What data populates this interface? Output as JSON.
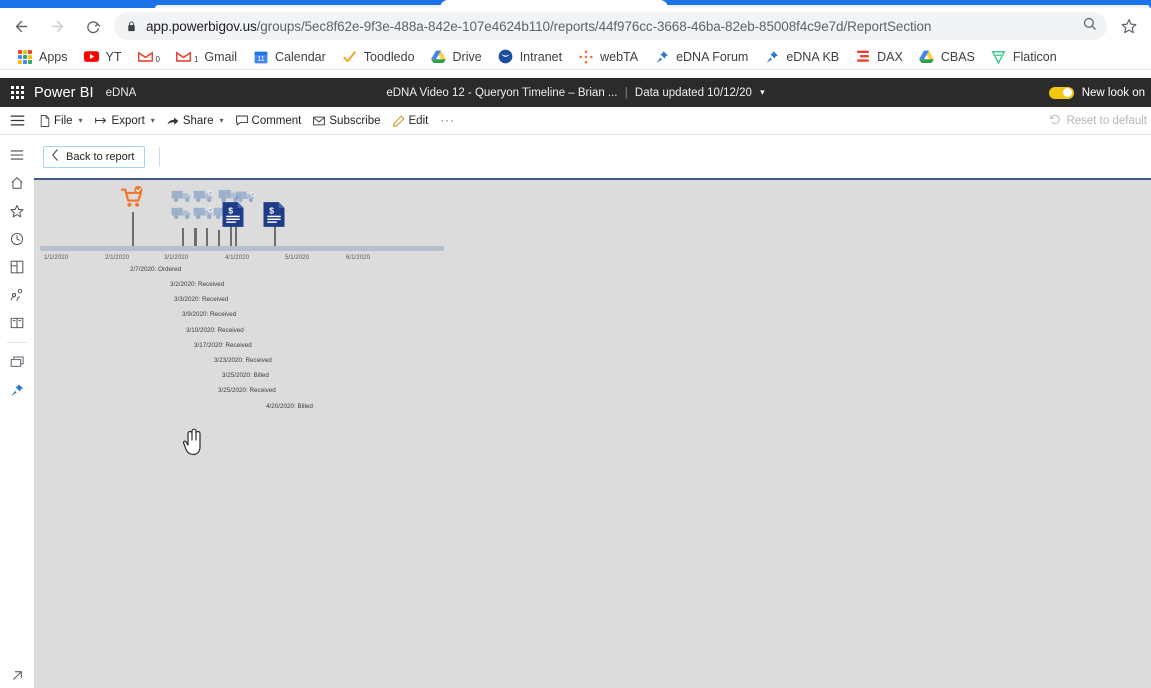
{
  "browser": {
    "back_icon": "back-arrow-icon",
    "forward_icon": "forward-arrow-icon",
    "reload_icon": "reload-icon",
    "lock_icon": "lock-icon",
    "url_host": "app.powerbigov.us",
    "url_path": "/groups/5ec8f62e-9f3e-488a-842e-107e4624b110/reports/44f976cc-3668-46ba-82eb-85008f4c9e7d/ReportSection",
    "zoom_icon": "zoom-search-icon",
    "star_icon": "bookmark-star-icon",
    "bookmarks": [
      {
        "label": "Apps",
        "icon": "apps-grid-icon"
      },
      {
        "label": "YT",
        "icon": "youtube-icon"
      },
      {
        "label": "",
        "icon": "gmail-icon-0"
      },
      {
        "label": "Gmail",
        "icon": "gmail-icon-1"
      },
      {
        "label": "Calendar",
        "icon": "calendar-icon"
      },
      {
        "label": "Toodledo",
        "icon": "checkmark-icon"
      },
      {
        "label": "Drive",
        "icon": "google-drive-icon"
      },
      {
        "label": "Intranet",
        "icon": "noaa-shield-icon"
      },
      {
        "label": "webTA",
        "icon": "webta-dots-icon"
      },
      {
        "label": "eDNA Forum",
        "icon": "blue-pin-icon"
      },
      {
        "label": "eDNA KB",
        "icon": "blue-pin-icon"
      },
      {
        "label": "DAX",
        "icon": "dax-bars-icon"
      },
      {
        "label": "CBAS",
        "icon": "google-drive-icon"
      },
      {
        "label": "Flaticon",
        "icon": "flaticon-icon"
      }
    ]
  },
  "powerbi": {
    "waffle_icon": "app-launcher-icon",
    "brand": "Power BI",
    "workspace": "eDNA",
    "report_title": "eDNA Video 12 - Queryon Timeline – Brian ...",
    "data_updated": "Data updated 10/12/20",
    "title_chevron_icon": "chevron-down-icon",
    "new_look_label": "New look on",
    "new_look_on": true,
    "accent_yellow": "#f2c811"
  },
  "actionbar": {
    "hamburger_icon": "hamburger-menu-icon",
    "items": [
      {
        "label": "File",
        "icon": "file-icon",
        "caret": true
      },
      {
        "label": "Export",
        "icon": "export-icon",
        "caret": true
      },
      {
        "label": "Share",
        "icon": "share-icon",
        "caret": true
      },
      {
        "label": "Comment",
        "icon": "comment-icon",
        "caret": false
      },
      {
        "label": "Subscribe",
        "icon": "subscribe-icon",
        "caret": false
      },
      {
        "label": "Edit",
        "icon": "edit-pencil-icon",
        "caret": false
      }
    ],
    "overflow_label": "···",
    "reset_label": "Reset to default",
    "reset_icon": "reset-undo-icon"
  },
  "rail": {
    "items": [
      {
        "name": "nav-toggle",
        "icon": "hamburger-menu-icon"
      },
      {
        "name": "home",
        "icon": "home-icon"
      },
      {
        "name": "favorites",
        "icon": "star-icon"
      },
      {
        "name": "recent",
        "icon": "clock-icon"
      },
      {
        "name": "apps",
        "icon": "apps-tiles-icon"
      },
      {
        "name": "shared-with-me",
        "icon": "people-share-icon"
      },
      {
        "name": "workspaces",
        "icon": "book-icon"
      },
      {
        "name": "my-workspace",
        "icon": "datasets-icon"
      },
      {
        "name": "edna-pin",
        "icon": "blue-pin-icon"
      }
    ],
    "bottom_icon": "expand-arrow-icon"
  },
  "report": {
    "back_label": "Back to report",
    "back_icon": "chevron-left-icon",
    "canvas_bg": "#dcdcdc"
  },
  "chart_data": {
    "type": "timeline",
    "title": "",
    "xlabel": "",
    "axis_ticks": [
      "1/1/2020",
      "2/1/2020",
      "3/1/2020",
      "4/1/2020",
      "5/1/2020",
      "6/1/2020"
    ],
    "axis_range": [
      "1/1/2020",
      "6/15/2020"
    ],
    "events": [
      {
        "date": "2/7/2020",
        "label": "2/7/2020: Ordered",
        "status": "Ordered",
        "icon": "shopping-cart-check-icon",
        "icon_color": "#f2762e"
      },
      {
        "date": "3/2/2020",
        "label": "3/2/2020: Received",
        "status": "Received",
        "icon": "delivery-truck-icon",
        "icon_color": "#7f9dc4"
      },
      {
        "date": "3/3/2020",
        "label": "3/3/2020: Received",
        "status": "Received",
        "icon": "delivery-truck-icon",
        "icon_color": "#7f9dc4"
      },
      {
        "date": "3/9/2020",
        "label": "3/9/2020: Received",
        "status": "Received",
        "icon": "delivery-truck-icon",
        "icon_color": "#7f9dc4"
      },
      {
        "date": "3/10/2020",
        "label": "3/10/2020: Received",
        "status": "Received",
        "icon": "delivery-truck-icon",
        "icon_color": "#7f9dc4"
      },
      {
        "date": "3/17/2020",
        "label": "3/17/2020: Received",
        "status": "Received",
        "icon": "delivery-truck-icon",
        "icon_color": "#7f9dc4"
      },
      {
        "date": "3/23/2020",
        "label": "3/23/2020: Received",
        "status": "Received",
        "icon": "delivery-truck-icon",
        "icon_color": "#7f9dc4"
      },
      {
        "date": "3/25/2020",
        "label": "3/25/2020: Billed",
        "status": "Billed",
        "icon": "invoice-document-icon",
        "icon_color": "#1f3c88"
      },
      {
        "date": "3/25/2020",
        "label": "3/25/2020: Received",
        "status": "Received",
        "icon": "delivery-truck-icon",
        "icon_color": "#7f9dc4"
      },
      {
        "date": "4/20/2020",
        "label": "4/20/2020: Billed",
        "status": "Billed",
        "icon": "invoice-document-icon",
        "icon_color": "#1f3c88"
      }
    ],
    "legend": [],
    "grid": false
  }
}
